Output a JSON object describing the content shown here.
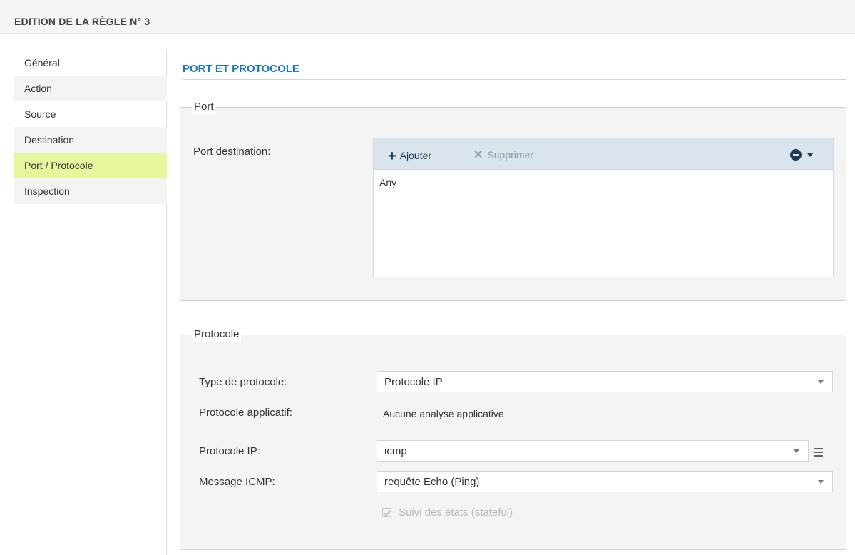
{
  "page": {
    "title": "EDITION DE LA RÈGLE N° 3"
  },
  "sidebar": {
    "items": [
      {
        "label": "Général",
        "active": false
      },
      {
        "label": "Action",
        "active": false
      },
      {
        "label": "Source",
        "active": false
      },
      {
        "label": "Destination",
        "active": false
      },
      {
        "label": "Port / Protocole",
        "active": true
      },
      {
        "label": "Inspection",
        "active": false
      }
    ]
  },
  "main": {
    "section_title": "PORT ET PROTOCOLE",
    "port": {
      "legend": "Port",
      "destination_label": "Port destination:",
      "toolbar": {
        "add_label": "Ajouter",
        "delete_label": "Supprimer"
      },
      "rows": [
        "Any"
      ]
    },
    "protocol": {
      "legend": "Protocole",
      "type_label": "Type de protocole:",
      "type_value": "Protocole IP",
      "app_label": "Protocole applicatif:",
      "app_value": "Aucune analyse applicative",
      "ip_label": "Protocole IP:",
      "ip_value": "icmp",
      "icmp_label": "Message ICMP:",
      "icmp_value": "requête Echo (Ping)",
      "stateful_label": "Suivi des états (stateful)",
      "stateful_checked": true,
      "stateful_disabled": true
    }
  },
  "colors": {
    "accent": "#1a78c2",
    "active_item": "#e4f79c",
    "toolbar": "#dae4ec"
  },
  "icons": [
    "plus-icon",
    "cross-icon",
    "minus-circle-icon",
    "caret-down-icon",
    "list-icon",
    "checkbox-icon"
  ]
}
